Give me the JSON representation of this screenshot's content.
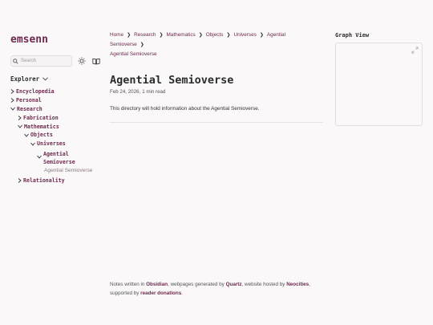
{
  "site": {
    "title": "emsenn"
  },
  "search": {
    "placeholder": "Search"
  },
  "explorer": {
    "title": "Explorer",
    "items": [
      {
        "label": "Encyclopedia"
      },
      {
        "label": "Personal"
      },
      {
        "label": "Research"
      },
      {
        "label": "Fabrication"
      },
      {
        "label": "Mathematics"
      },
      {
        "label": "Objects"
      },
      {
        "label": "Universes"
      },
      {
        "label": "Agential"
      },
      {
        "label": "Semioverse"
      },
      {
        "label": "Agential Semioverse"
      },
      {
        "label": "Relationality"
      }
    ]
  },
  "breadcrumb": {
    "items": [
      "Home",
      "Research",
      "Mathematics",
      "Objects",
      "Universes",
      "Agential Semioverse",
      "Agential Semioverse"
    ],
    "separator": "❯"
  },
  "page": {
    "title": "Agential Semioverse",
    "date": "Feb 24, 2026,",
    "reading_time": "1 min read",
    "body": "This directory will hold information about the Agential Semioverse."
  },
  "graph": {
    "title": "Graph View"
  },
  "footer": {
    "p1": "Notes written in ",
    "obsidian": "Obsidian",
    "p2": ", webpages generated by ",
    "quartz": "Quartz",
    "p3": ", website hosted by ",
    "neocities": "Neocities",
    "p4": ",",
    "p5": "supported by ",
    "donations": "reader donations",
    "p6": "."
  },
  "colors": {
    "accent": "#6b2a4e",
    "background": "#faf8f8",
    "text": "#2b2b2b"
  }
}
